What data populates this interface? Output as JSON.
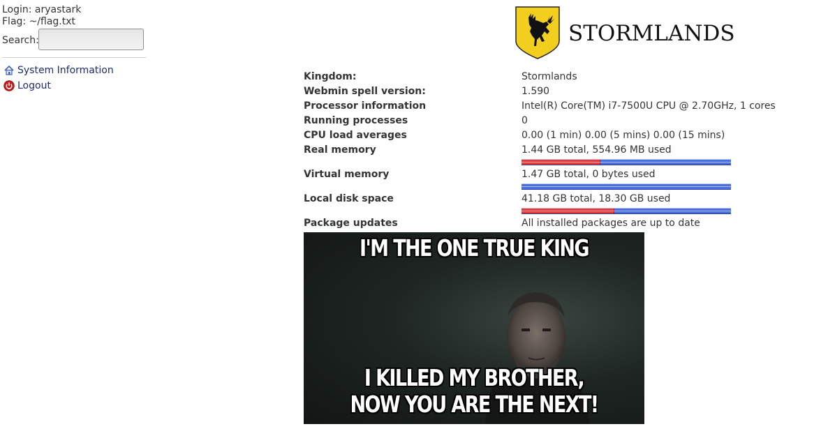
{
  "left_frame": {
    "login": "Login: aryastark",
    "flag": "Flag: ~/flag.txt",
    "search_label": "Search:",
    "search_value": "",
    "nav": [
      {
        "label": "System Information",
        "icon": "house-icon"
      },
      {
        "label": "Logout",
        "icon": "power-icon"
      }
    ]
  },
  "header": {
    "logo_text": "STORMLANDS",
    "colors": {
      "shield_fill": "#f2cf1f",
      "stag": "#111111"
    }
  },
  "system_info": {
    "rows": [
      {
        "label": "Kingdom:",
        "value": "Stormlands"
      },
      {
        "label": "Webmin spell version:",
        "value": "1.590"
      },
      {
        "label": "Processor information",
        "value": "Intel(R) Core(TM) i7-7500U CPU @ 2.70GHz, 1 cores"
      },
      {
        "label": "Running processes",
        "value": "0"
      },
      {
        "label": "CPU load averages",
        "value": "0.00 (1 min) 0.00 (5 mins) 0.00 (15 mins)"
      },
      {
        "label": "Real memory",
        "value": "1.44 GB total, 554.96 MB used",
        "used_fraction": 0.376
      },
      {
        "label": "Virtual memory",
        "value": "1.47 GB total, 0 bytes used",
        "used_fraction": 0
      },
      {
        "label": "Local disk space",
        "value": "41.18 GB total, 18.30 GB used",
        "used_fraction": 0.444
      },
      {
        "label": "Package updates",
        "value": "All installed packages are up to date"
      }
    ],
    "colors": {
      "used": "#e83838",
      "free": "#4a6ee0"
    }
  },
  "meme": {
    "top_text": "I'M THE ONE TRUE KING",
    "bottom_line1": "I KILLED MY BROTHER,",
    "bottom_line2": "NOW YOU ARE THE NEXT!"
  }
}
